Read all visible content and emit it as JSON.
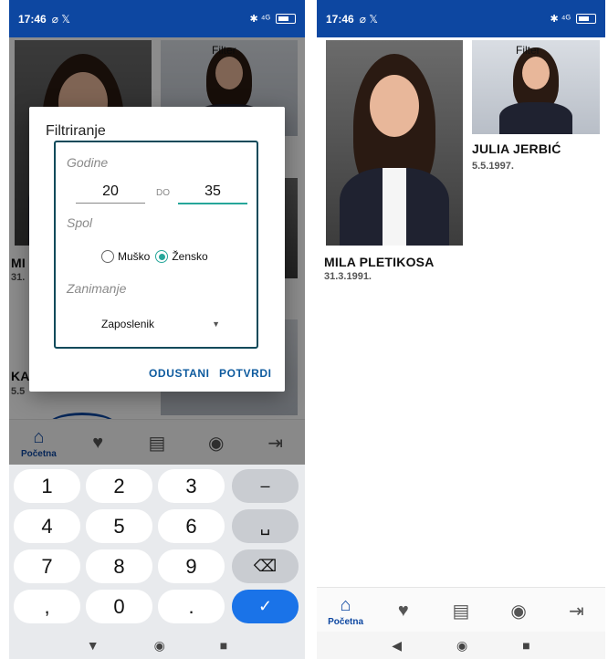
{
  "status": {
    "time": "17:46",
    "left_icons": "⌀ 𝕏",
    "right_icons": "✱ ⁴ᴳ",
    "battery": "80"
  },
  "filter_overlay_text": "Filter",
  "cards": [
    {
      "name": "MILA PLETIKOSA",
      "date": "31.3.1991."
    },
    {
      "name": "JULIA JERBIĆ",
      "date": "5.5.1997."
    }
  ],
  "left_partial": {
    "name1": "MI",
    "date1": "31.",
    "name2": "KA",
    "date2": "5.5"
  },
  "dialog": {
    "title": "Filtriranje",
    "age_label": "Godine",
    "age_from": "20",
    "age_sep": "DO",
    "age_to": "35",
    "gender_label": "Spol",
    "gender_options": [
      "Muško",
      "Žensko"
    ],
    "gender_selected": "Žensko",
    "occupation_label": "Zanimanje",
    "occupation_value": "Zaposlenik",
    "cancel": "ODUSTANI",
    "confirm": "POTVRDI"
  },
  "nav": {
    "home_label": "Početna"
  },
  "keyboard": {
    "rows": [
      [
        "1",
        "2",
        "3",
        "–"
      ],
      [
        "4",
        "5",
        "6",
        "␣"
      ],
      [
        "7",
        "8",
        "9",
        "⌫"
      ],
      [
        ",",
        "0",
        ".",
        "✓"
      ]
    ]
  }
}
